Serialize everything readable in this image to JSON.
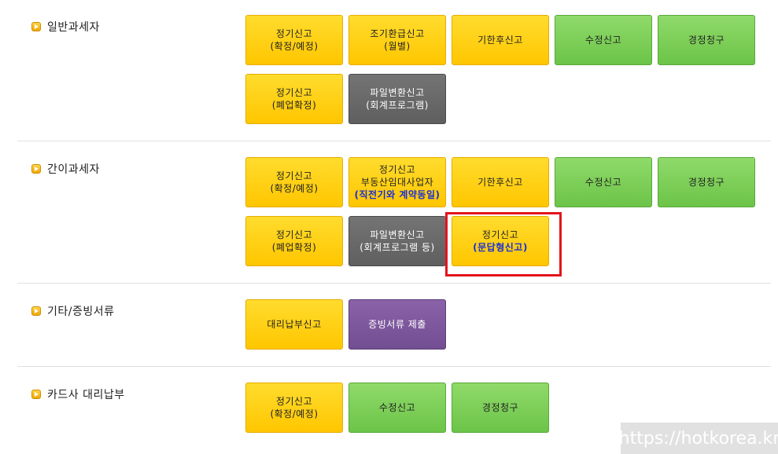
{
  "sections": [
    {
      "title": "일반과세자",
      "buttons": [
        {
          "line1": "정기신고",
          "line2": "(확정/예정)"
        },
        {
          "line1": "조기환급신고",
          "line2": "(월별)"
        },
        {
          "line1": "기한후신고"
        },
        {
          "line1": "수정신고"
        },
        {
          "line1": "경정청구"
        },
        {
          "line1": "정기신고",
          "line2": "(폐업확정)"
        },
        {
          "line1": "파일변환신고",
          "line2": "(회계프로그램)"
        }
      ]
    },
    {
      "title": "간이과세자",
      "buttons": [
        {
          "line1": "정기신고",
          "line2": "(확정/예정)"
        },
        {
          "line1": "정기신고",
          "line2": "부동산임대사업자",
          "line3": "(직전기와 계약동일)"
        },
        {
          "line1": "기한후신고"
        },
        {
          "line1": "수정신고"
        },
        {
          "line1": "경정청구"
        },
        {
          "line1": "정기신고",
          "line2": "(폐업확정)"
        },
        {
          "line1": "파일변환신고",
          "line2": "(회계프로그램 등)"
        },
        {
          "line1": "정기신고",
          "line2": "(문답형신고)"
        }
      ]
    },
    {
      "title": "기타/증빙서류",
      "buttons": [
        {
          "line1": "대리납부신고"
        },
        {
          "line1": "증빙서류 제출"
        }
      ]
    },
    {
      "title": "카드사 대리납부",
      "buttons": [
        {
          "line1": "정기신고",
          "line2": "(확정/예정)"
        },
        {
          "line1": "수정신고"
        },
        {
          "line1": "경정청구"
        }
      ]
    }
  ],
  "colors": {
    "yellow": "#ffcc00",
    "green": "#7ccf55",
    "gray": "#666666",
    "purple": "#7a559a",
    "highlight": "#e3141c",
    "blue_text": "#1a2fd6"
  },
  "watermark": "https://hotkorea.kr"
}
